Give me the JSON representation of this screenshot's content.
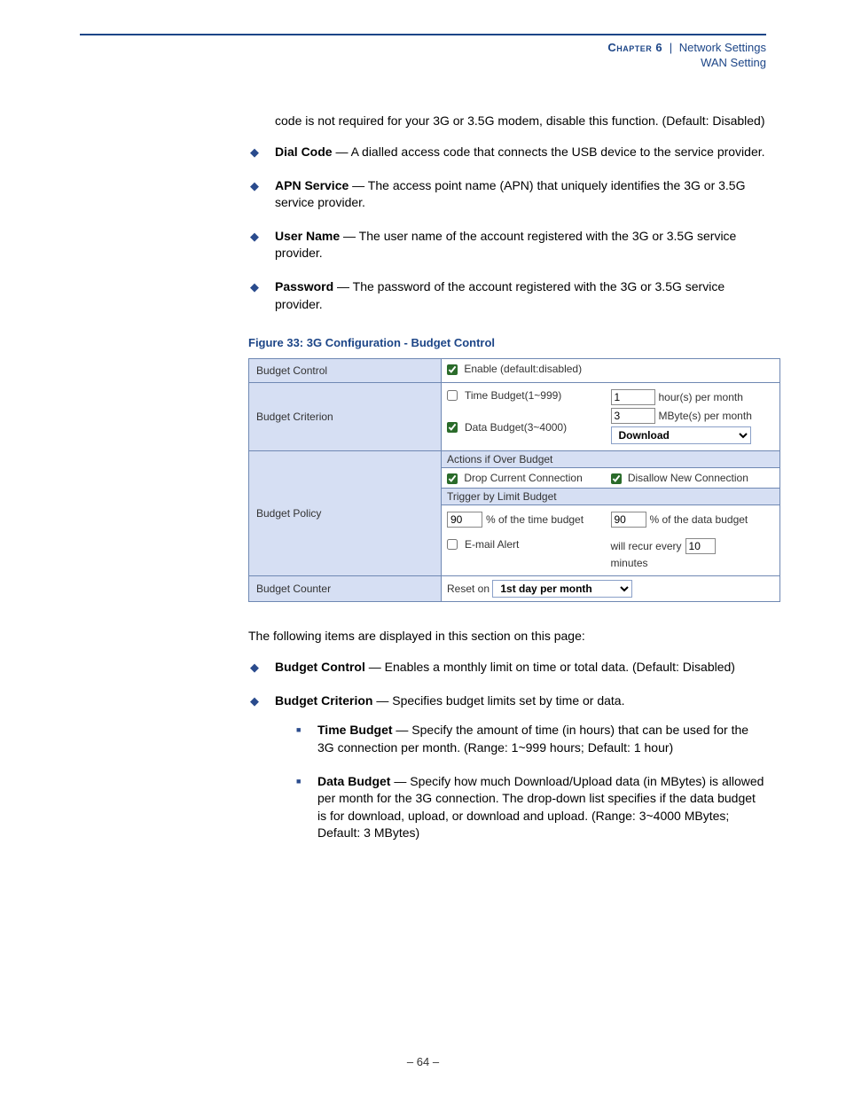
{
  "header": {
    "chapter": "Chapter 6",
    "sep": "|",
    "title": "Network Settings",
    "subtitle": "WAN Setting"
  },
  "intro": "code is not required for your 3G or 3.5G modem, disable this function. (Default: Disabled)",
  "top_bullets": [
    {
      "term": "Dial Code",
      "desc": " — A dialled access code that connects the USB device to the service provider."
    },
    {
      "term": "APN Service",
      "desc": " — The access point name (APN) that uniquely identifies the 3G or 3.5G service provider."
    },
    {
      "term": "User Name",
      "desc": " — The user name of the account registered with the 3G or 3.5G service provider."
    },
    {
      "term": "Password",
      "desc": " — The password of the account registered with the 3G or 3.5G service provider."
    }
  ],
  "figure_caption": "Figure 33:  3G Configuration - Budget Control",
  "cfg": {
    "budget_control_label": "Budget Control",
    "enable_label": "Enable (default:disabled)",
    "enable_checked": true,
    "criterion_label": "Budget Criterion",
    "time_budget_label": "Time Budget(1~999)",
    "time_budget_checked": false,
    "time_budget_value": "1",
    "time_budget_unit": "hour(s) per month",
    "data_budget_label": "Data Budget(3~4000)",
    "data_budget_checked": true,
    "data_budget_value": "3",
    "data_budget_unit": "MByte(s) per month",
    "data_budget_select": "Download",
    "policy_label": "Budget Policy",
    "actions_hdr": "Actions if Over Budget",
    "drop_label": "Drop Current Connection",
    "drop_checked": true,
    "disallow_label": "Disallow New Connection",
    "disallow_checked": true,
    "trigger_hdr": "Trigger by Limit Budget",
    "time_pct": "90",
    "time_pct_suffix": "% of the time budget",
    "data_pct": "90",
    "data_pct_suffix": "% of the data budget",
    "email_label": "E-mail Alert",
    "email_checked": false,
    "recur_prefix": "will recur every",
    "recur_value": "10",
    "recur_suffix": "minutes",
    "counter_label": "Budget Counter",
    "reset_prefix": "Reset on",
    "reset_select": "1st day per month"
  },
  "following": "The following items are displayed in this section on this page:",
  "bottom_bullets": [
    {
      "term": "Budget Control",
      "desc": " — Enables a monthly limit on time or total data. (Default: Disabled)"
    },
    {
      "term": "Budget Criterion",
      "desc": " — Specifies budget limits set by time or data.",
      "subs": [
        {
          "term": "Time Budget",
          "desc": " — Specify the amount of time (in hours) that can be used for the 3G connection per month. (Range: 1~999 hours; Default: 1 hour)"
        },
        {
          "term": "Data Budget",
          "desc": " — Specify how much Download/Upload data (in MBytes) is allowed per month for the 3G connection. The drop-down list specifies if the data budget is for download, upload, or download and upload. (Range: 3~4000 MBytes; Default: 3 MBytes)"
        }
      ]
    }
  ],
  "page_number": "– 64 –"
}
